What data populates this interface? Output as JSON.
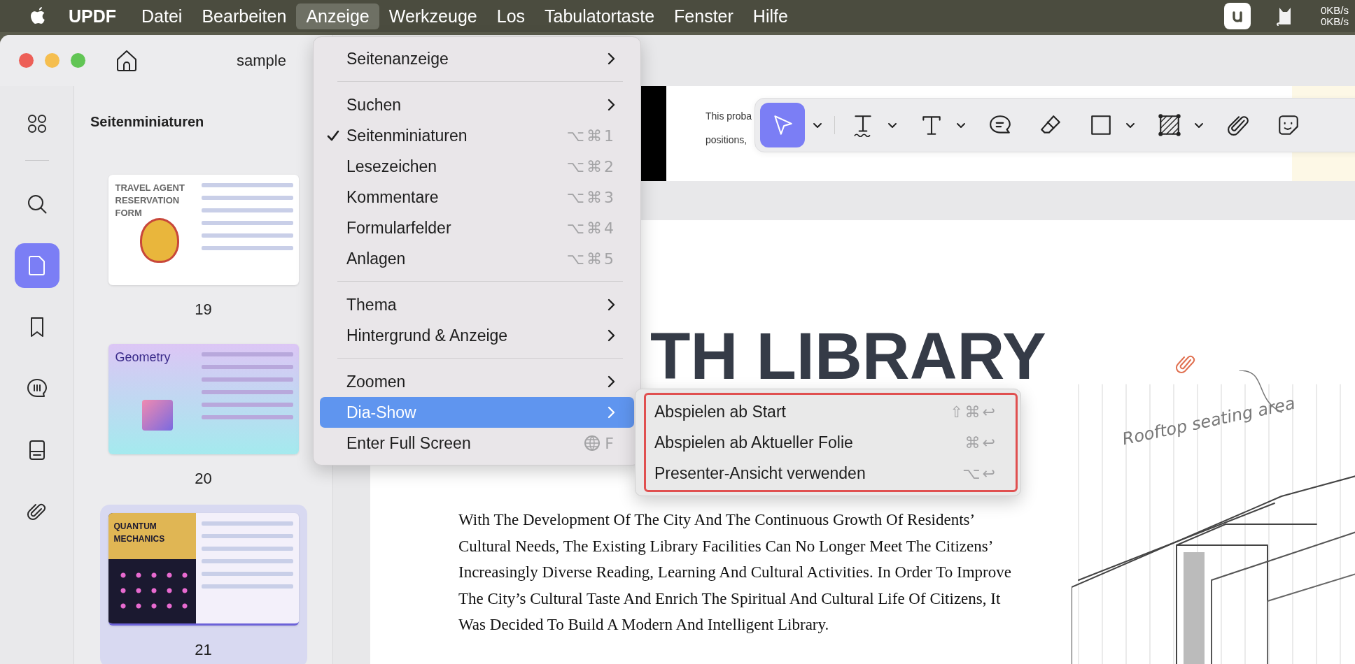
{
  "menubar": {
    "app_name": "UPDF",
    "menus": [
      {
        "label": "Datei",
        "selected": false
      },
      {
        "label": "Bearbeiten",
        "selected": false
      },
      {
        "label": "Anzeige",
        "selected": true
      },
      {
        "label": "Werkzeuge",
        "selected": false
      },
      {
        "label": "Los",
        "selected": false
      },
      {
        "label": "Tabulatortaste",
        "selected": false
      },
      {
        "label": "Fenster",
        "selected": false
      },
      {
        "label": "Hilfe",
        "selected": false
      }
    ],
    "network_speeds": [
      "0KB/s",
      "0KB/s"
    ]
  },
  "window": {
    "title": "sample"
  },
  "sidebar": {
    "tools": [
      {
        "selected": false
      },
      {
        "selected": false
      },
      {
        "selected": true
      },
      {
        "selected": false
      },
      {
        "selected": false
      },
      {
        "selected": false
      },
      {
        "selected": false
      }
    ]
  },
  "thumbnails": {
    "title": "Seitenminiaturen",
    "pages": [
      {
        "label": "19",
        "heading": "TRAVEL AGENT RESERVATION FORM",
        "kind": "form",
        "selected": false
      },
      {
        "label": "20",
        "heading": "Geometry",
        "kind": "gradient",
        "selected": false
      },
      {
        "label": "21",
        "heading": "QUANTUM MECHANICS",
        "kind": "poster",
        "selected": true
      }
    ]
  },
  "toolbar": {
    "tools": [
      {
        "selected": true,
        "dropdown": true
      },
      {
        "selected": false,
        "dropdown": true
      },
      {
        "selected": false,
        "dropdown": true
      },
      {
        "selected": false,
        "dropdown": false
      },
      {
        "selected": false,
        "dropdown": false
      },
      {
        "selected": false,
        "dropdown": true
      },
      {
        "selected": false,
        "dropdown": true
      },
      {
        "selected": false,
        "dropdown": false
      },
      {
        "selected": false,
        "dropdown": false
      }
    ]
  },
  "document": {
    "top_page_lines": [
      "This proba",
      "positions,"
    ],
    "heading": "TH LIBRARY",
    "paragraph": "With The Development Of The City And The Continuous Growth Of Residents’ Cultural Needs, The Existing Library Facilities Can No Longer Meet The Citizens’ Increasingly Diverse Reading, Learning And Cultural Activities. In Order To Improve The City’s Cultural Taste And Enrich The Spiritual And Cultural Life Of Citizens, It Was Decided To Build A Modern And Intelligent Library.",
    "illustration_caption": "Rooftop seating area"
  },
  "view_menu": {
    "groups": [
      [
        {
          "label": "Seitenanzeige",
          "kind": "submenu",
          "checked": false,
          "selected": false
        }
      ],
      [
        {
          "label": "Suchen",
          "kind": "submenu",
          "checked": false,
          "selected": false
        },
        {
          "label": "Seitenminiaturen",
          "kind": "command",
          "shortcut": "⌥⌘1",
          "checked": true,
          "selected": false
        },
        {
          "label": "Lesezeichen",
          "kind": "command",
          "shortcut": "⌥⌘2",
          "checked": false,
          "selected": false
        },
        {
          "label": "Kommentare",
          "kind": "command",
          "shortcut": "⌥⌘3",
          "checked": false,
          "selected": false
        },
        {
          "label": "Formularfelder",
          "kind": "command",
          "shortcut": "⌥⌘4",
          "checked": false,
          "selected": false
        },
        {
          "label": "Anlagen",
          "kind": "command",
          "shortcut": "⌥⌘5",
          "checked": false,
          "selected": false
        }
      ],
      [
        {
          "label": "Thema",
          "kind": "submenu",
          "checked": false,
          "selected": false
        },
        {
          "label": "Hintergrund & Anzeige",
          "kind": "submenu",
          "checked": false,
          "selected": false
        }
      ],
      [
        {
          "label": "Zoomen",
          "kind": "submenu",
          "checked": false,
          "selected": false
        },
        {
          "label": "Dia-Show",
          "kind": "submenu",
          "checked": false,
          "selected": true
        },
        {
          "label": "Enter Full Screen",
          "kind": "fncommand",
          "shortcut": "F",
          "checked": false,
          "selected": false
        }
      ]
    ]
  },
  "slideshow_submenu": {
    "items": [
      {
        "label": "Abspielen ab Start",
        "shortcut": "⇧⌘↩"
      },
      {
        "label": "Abspielen ab Aktueller Folie",
        "shortcut": "⌘↩"
      },
      {
        "label": "Presenter-Ansicht verwenden",
        "shortcut": "⌥↩"
      }
    ]
  }
}
